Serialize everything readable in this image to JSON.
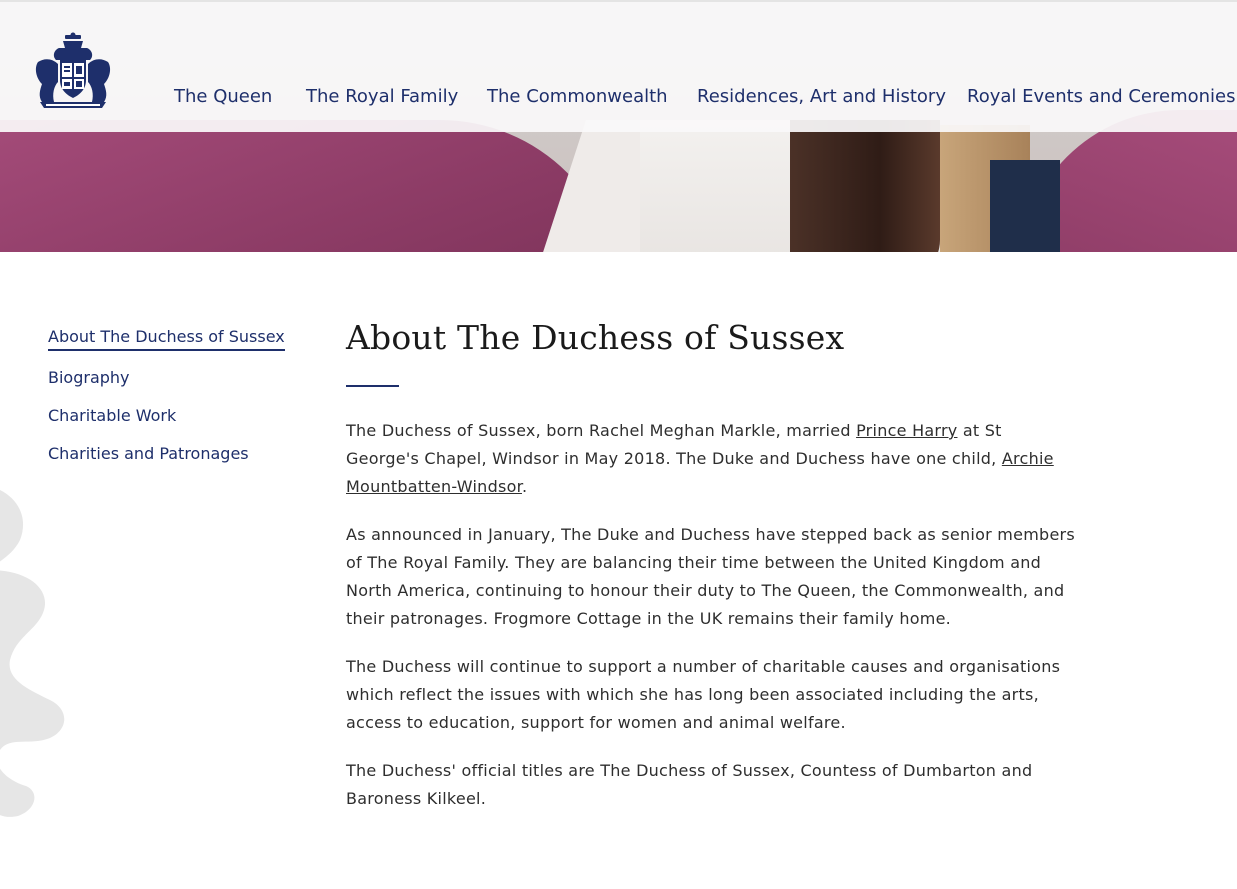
{
  "header": {
    "crest_icon": "royal-coat-of-arms-icon",
    "nav": [
      {
        "label": "The Queen"
      },
      {
        "label": "The Royal Family"
      },
      {
        "label": "The Commonwealth"
      },
      {
        "label": "Residences, Art and History"
      },
      {
        "label": "Royal Events and Ceremonies"
      }
    ]
  },
  "sidebar": {
    "items": [
      {
        "label": "About The Duchess of Sussex",
        "active": true
      },
      {
        "label": "Biography"
      },
      {
        "label": "Charitable Work"
      },
      {
        "label": "Charities and Patronages"
      }
    ]
  },
  "main": {
    "title": "About The Duchess of Sussex",
    "p1": {
      "before": "The Duchess of Sussex, born Rachel Meghan Markle, married ",
      "link1": "Prince Harry",
      "middle": " at St George's Chapel, Windsor in May 2018. The Duke and Duchess have one child, ",
      "link2": "Archie Mountbatten-Windsor",
      "after": "."
    },
    "p2": "As announced in January, The Duke and Duchess have stepped back as senior members of The Royal Family. They are balancing their time between the United Kingdom and North America, continuing to honour their duty to The Queen, the Commonwealth, and their patronages. Frogmore Cottage in the UK remains their family home.",
    "p3": "The Duchess will continue to support a number of charitable causes and organisations which reflect the issues with which she has long been associated including the arts, access to education, support for women and animal welfare.",
    "p4": "The Duchess' official titles are The Duchess of Sussex, Countess of Dumbarton and Baroness Kilkeel."
  },
  "colors": {
    "nav_text": "#1e2f6b",
    "body_text": "#2e2e2e",
    "accent_rule": "#1e2f6b",
    "banner_magenta": "#8d3c66"
  }
}
